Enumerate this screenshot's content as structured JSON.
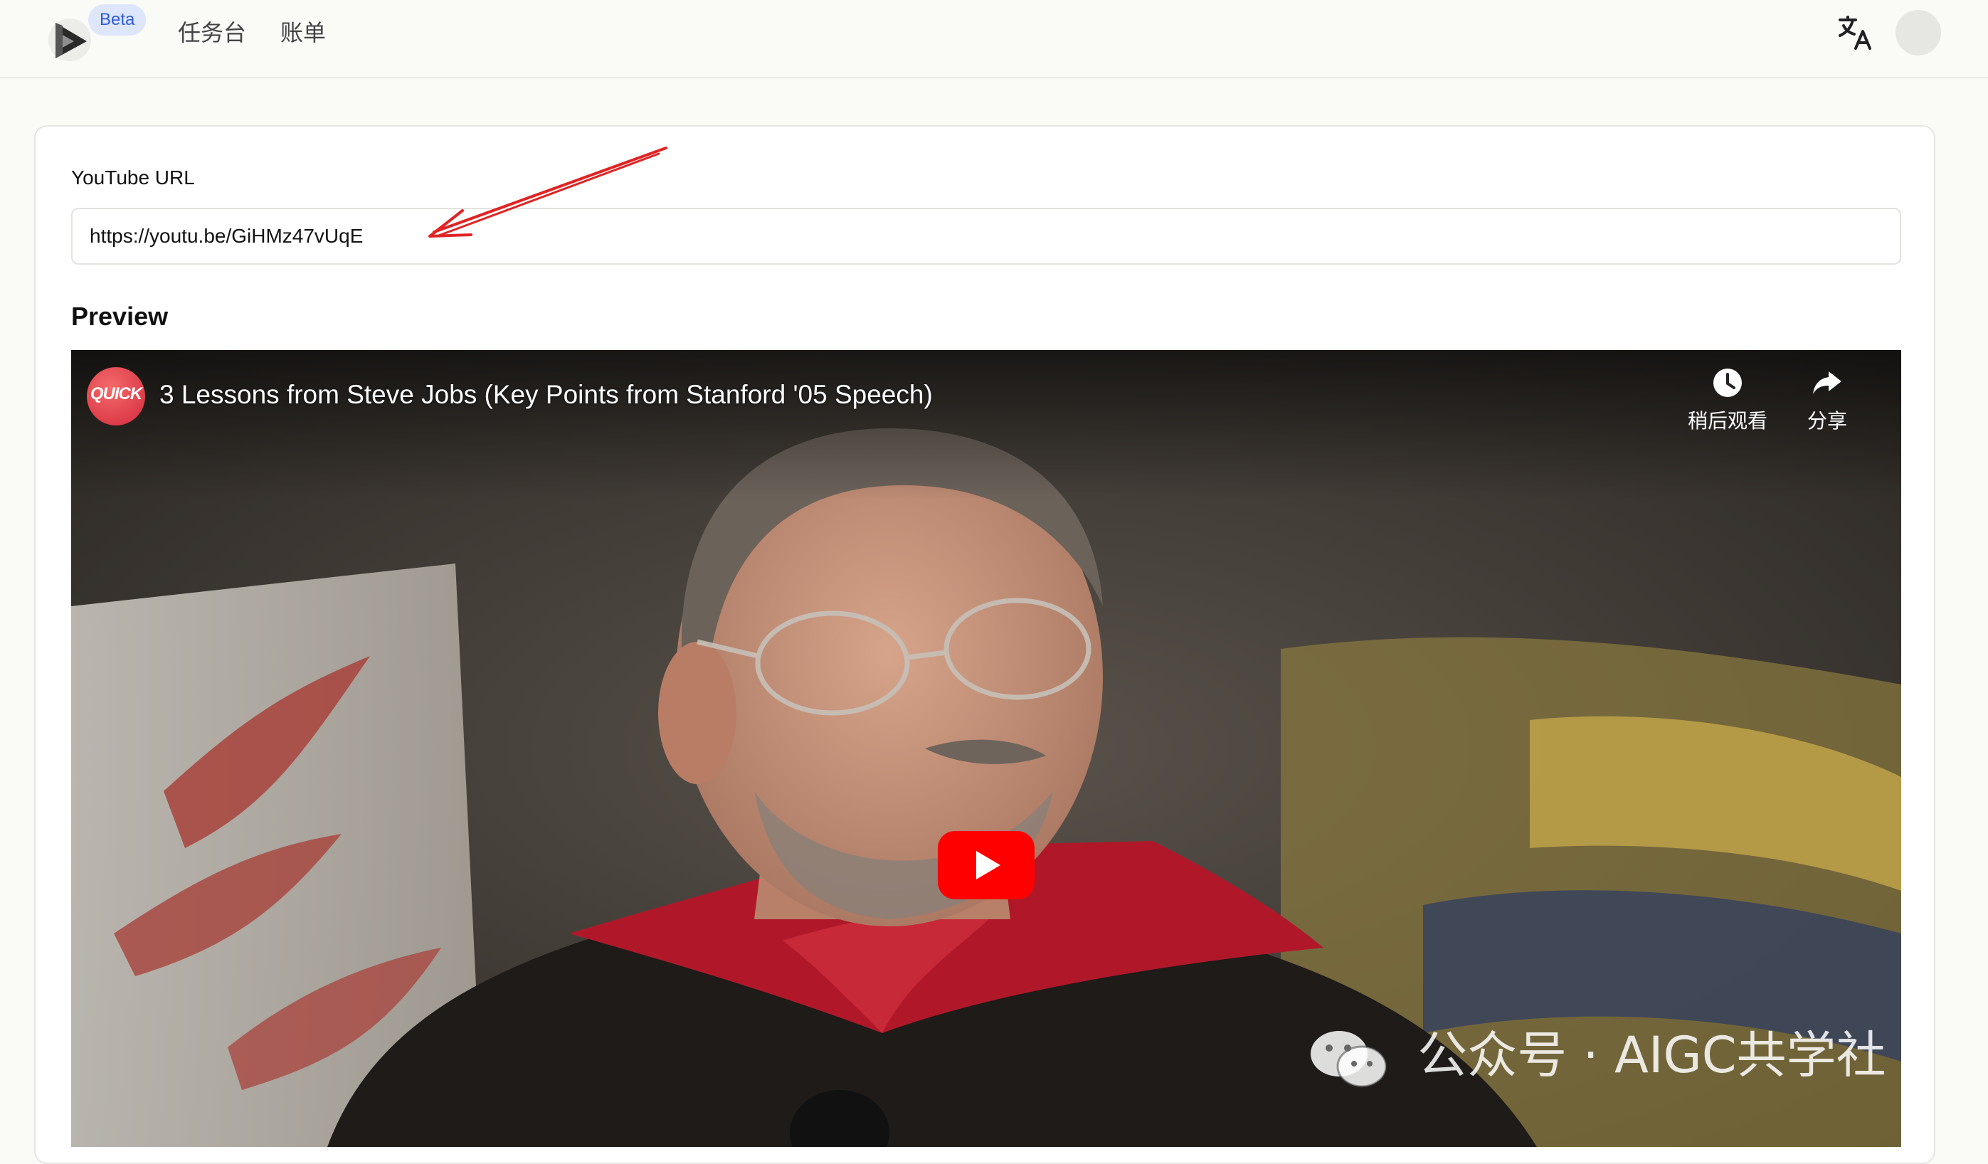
{
  "app": {
    "badge": "Beta",
    "nav": [
      {
        "label": "任务台"
      },
      {
        "label": "账单"
      }
    ],
    "icons": {
      "logo": "play-logo-icon",
      "translate": "translate-icon",
      "avatar": "user-avatar"
    }
  },
  "form": {
    "url_label": "YouTube URL",
    "url_value": "https://youtu.be/GiHMz47vUqE"
  },
  "preview": {
    "heading": "Preview",
    "video": {
      "channel_badge": "QUICK",
      "title": "3 Lessons from Steve Jobs (Key Points from Stanford '05 Speech)",
      "watch_later_label": "稍后观看",
      "share_label": "分享",
      "play_icon": "play-icon"
    }
  },
  "watermark": {
    "text": "公众号 · AIGC共学社",
    "icon": "wechat-icon"
  },
  "colors": {
    "accent_badge_bg": "#dde6fb",
    "accent_badge_text": "#2f5bd7",
    "youtube_red": "#ff0000",
    "annotation_arrow": "#e02424"
  }
}
